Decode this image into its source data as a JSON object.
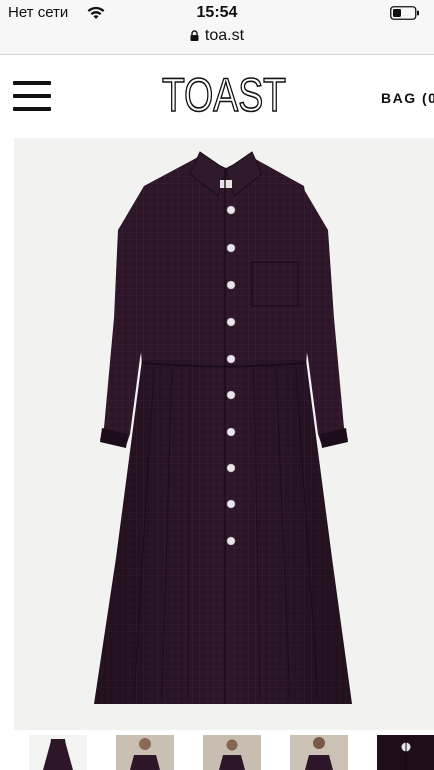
{
  "status_bar": {
    "carrier": "Нет сети",
    "time": "15:54"
  },
  "browser": {
    "url": "toa.st"
  },
  "header": {
    "logo_text": "TOAST",
    "bag_label": "BAG (0"
  },
  "product": {
    "main_image": "plum check shirt dress with white buttons",
    "thumbnails": [
      "dress-front-thumbnail",
      "model-front-thumbnail",
      "model-side-thumbnail",
      "model-back-thumbnail",
      "button-detail-thumbnail"
    ]
  },
  "colors": {
    "dress": "#2c1628",
    "dress_shadow": "#1d0d1b",
    "image_bg": "#f2f2f1",
    "chrome_bg": "#f7f7f7"
  }
}
